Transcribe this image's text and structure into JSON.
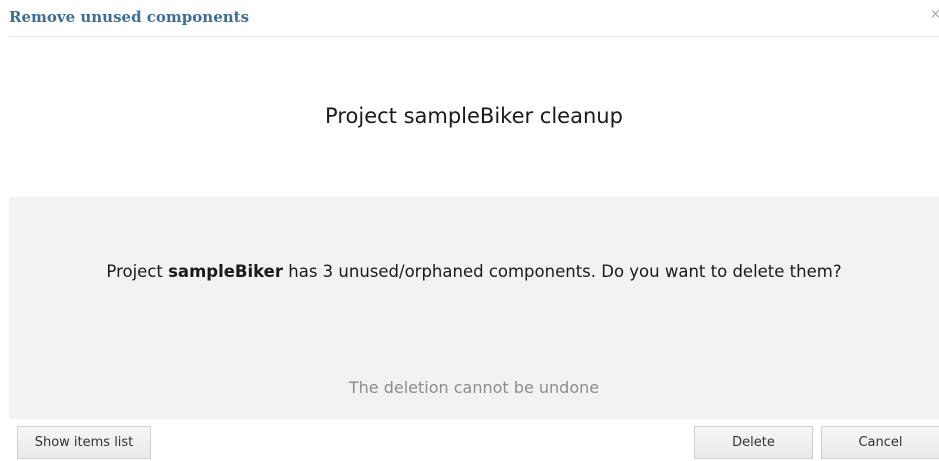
{
  "dialog": {
    "title": "Remove unused components",
    "close_symbol": "×"
  },
  "heading": "Project sampleBiker cleanup",
  "message": {
    "prefix": "Project ",
    "project_name": "sampleBiker",
    "suffix": " has 3 unused/orphaned components. Do you want to delete them?"
  },
  "warning": "The deletion cannot be undone",
  "buttons": {
    "show_items": "Show items list",
    "delete": "Delete",
    "cancel": "Cancel"
  },
  "colors": {
    "title": "#3e6d96",
    "message_background": "#f2f2f2",
    "warning_text": "#8c8c8c"
  }
}
